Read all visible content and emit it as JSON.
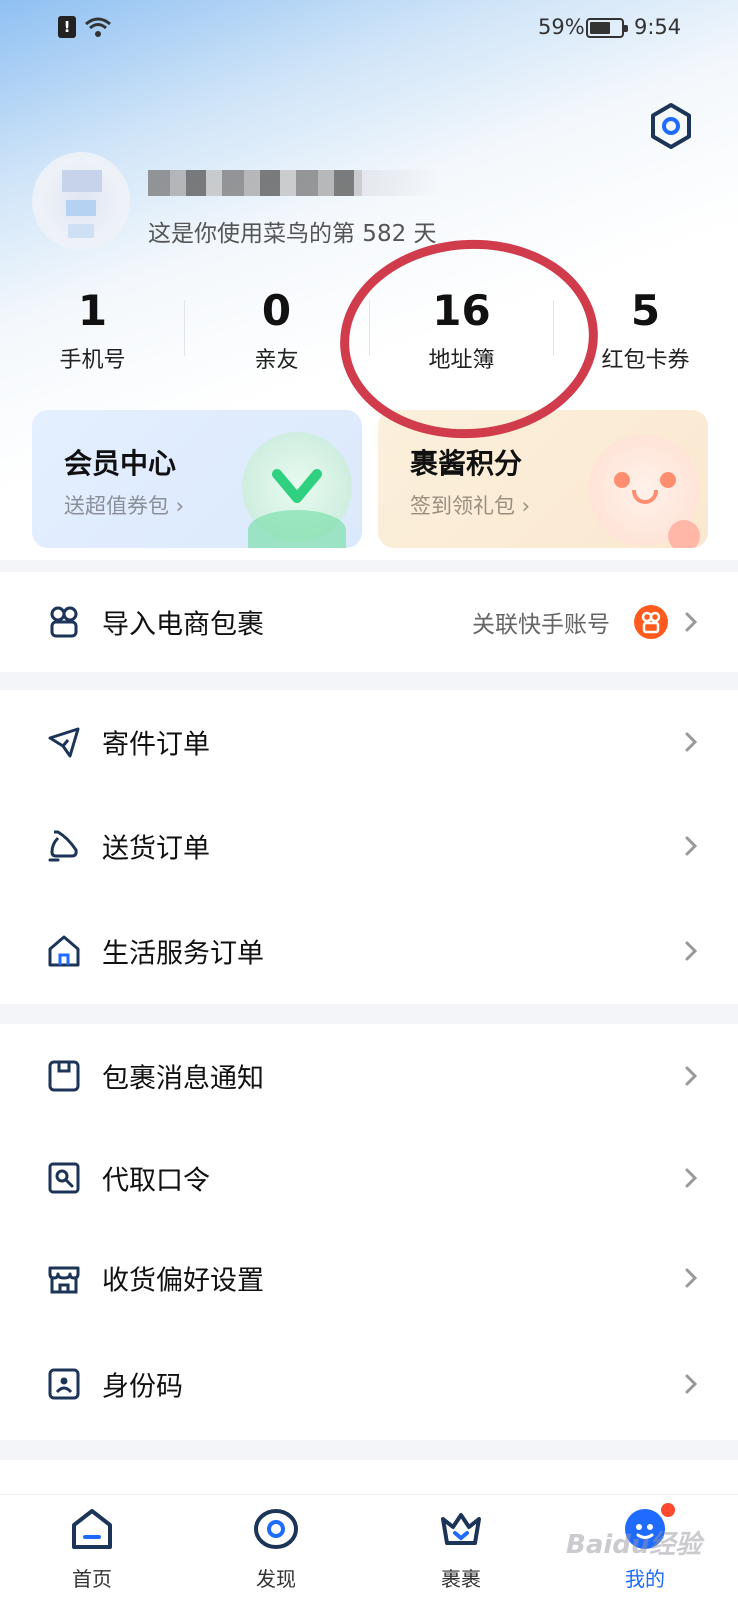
{
  "status_bar": {
    "battery_pct": "59%",
    "time": "9:54"
  },
  "profile": {
    "days_text": "这是你使用菜鸟的第 582 天"
  },
  "stats": [
    {
      "value": "1",
      "label": "手机号"
    },
    {
      "value": "0",
      "label": "亲友"
    },
    {
      "value": "16",
      "label": "地址簿"
    },
    {
      "value": "5",
      "label": "红包卡券"
    }
  ],
  "cards": {
    "member": {
      "title": "会员中心",
      "subtitle": "送超值券包 ›"
    },
    "points": {
      "title": "裹酱积分",
      "subtitle": "签到领礼包 ›"
    }
  },
  "import_row": {
    "label": "导入电商包裹",
    "right_text": "关联快手账号"
  },
  "order_section": [
    {
      "label": "寄件订单",
      "icon": "send-icon"
    },
    {
      "label": "送货订单",
      "icon": "delivery-icon"
    },
    {
      "label": "生活服务订单",
      "icon": "home-icon"
    }
  ],
  "settings_section": [
    {
      "label": "包裹消息通知",
      "icon": "package-notice-icon"
    },
    {
      "label": "代取口令",
      "icon": "pickup-code-icon"
    },
    {
      "label": "收货偏好设置",
      "icon": "store-icon"
    },
    {
      "label": "身份码",
      "icon": "id-code-icon"
    }
  ],
  "tabbar": [
    {
      "label": "首页",
      "icon": "home-tab-icon"
    },
    {
      "label": "发现",
      "icon": "discover-tab-icon"
    },
    {
      "label": "裹裹",
      "icon": "crown-tab-icon"
    },
    {
      "label": "我的",
      "icon": "me-tab-icon",
      "active": true
    }
  ],
  "watermark": "Baidu经验",
  "colors": {
    "accent": "#1f6bff",
    "highlight_circle": "#d13c4d",
    "icon_dark": "#1c3457"
  }
}
